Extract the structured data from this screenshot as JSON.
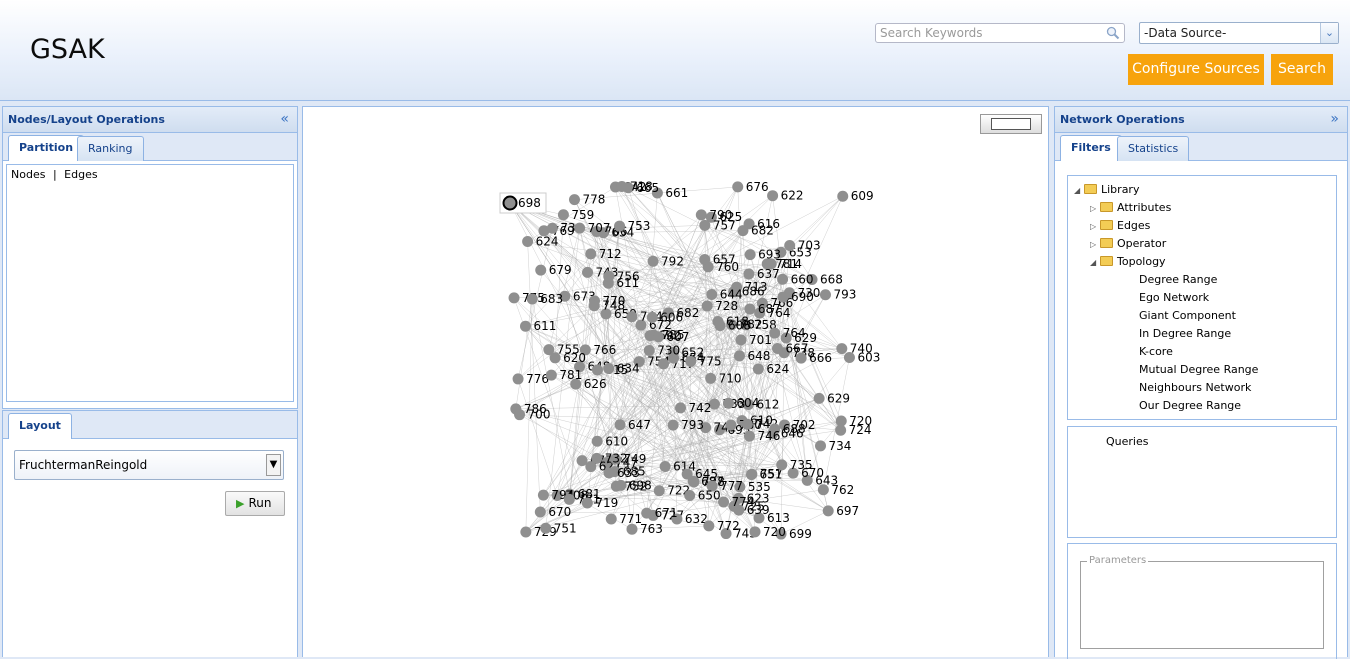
{
  "app_title": "GSAK",
  "search": {
    "placeholder": "Search Keywords",
    "icon": "magnifier-icon"
  },
  "data_source": {
    "selected": "-Data Source-"
  },
  "buttons": {
    "configure": "Configure Sources",
    "search": "Search"
  },
  "left_panel": {
    "title": "Nodes/Layout Operations",
    "tabs": [
      "Partition",
      "Ranking"
    ],
    "active_tab": "Partition",
    "partition": {
      "nodes": "Nodes",
      "separator": "|",
      "edges": "Edges"
    }
  },
  "layout_panel": {
    "tab": "Layout",
    "algorithm": "FruchtermanReingold",
    "run": "Run"
  },
  "right_panel": {
    "title": "Network Operations",
    "tabs": [
      "Filters",
      "Statistics"
    ],
    "active_tab": "Filters",
    "tree": {
      "library": "Library",
      "folders": [
        "Attributes",
        "Edges",
        "Operator"
      ],
      "topology": "Topology",
      "topology_items": [
        "Degree Range",
        "Ego Network",
        "Giant Component",
        "In Degree Range",
        "K-core",
        "Mutual Degree Range",
        "Neighbours Network",
        "Our Degree Range"
      ]
    },
    "queries": "Queries",
    "parameters": "Parameters"
  },
  "graph": {
    "selected_node": "698",
    "node_color": "#8f8f8f",
    "edge_color": "#a8a8a8",
    "node_labels": [
      "698",
      "686",
      "745",
      "610",
      "681",
      "651",
      "766",
      "653",
      "760",
      "677",
      "643",
      "755",
      "764",
      "659",
      "762",
      "785",
      "703",
      "673",
      "754",
      "740",
      "781",
      "722",
      "730",
      "687",
      "616",
      "625",
      "758",
      "637",
      "672",
      "727",
      "661",
      "766",
      "676",
      "611",
      "792",
      "738",
      "728",
      "695",
      "776",
      "717",
      "713",
      "632",
      "648",
      "629",
      "786",
      "782",
      "702",
      "747",
      "603",
      "626",
      "535",
      "741",
      "670",
      "679",
      "614",
      "752",
      "621",
      "692",
      "775",
      "757",
      "699",
      "777",
      "642",
      "615",
      "780",
      "648",
      "725",
      "682",
      "657",
      "701",
      "647",
      "744",
      "770",
      "781",
      "724",
      "645",
      "690",
      "652",
      "708",
      "665",
      "618",
      "769",
      "736",
      "646",
      "687",
      "766",
      "793",
      "794",
      "763",
      "743",
      "772",
      "610",
      "685",
      "634",
      "624",
      "742",
      "654",
      "622",
      "620",
      "682",
      "612",
      "728",
      "607",
      "644",
      "697",
      "608",
      "668",
      "611",
      "671",
      "609",
      "606",
      "781",
      "771",
      "720",
      "667",
      "623",
      "749",
      "733",
      "790",
      "734",
      "700",
      "633",
      "613",
      "650",
      "707",
      "719",
      "660",
      "698",
      "688",
      "693",
      "670",
      "714",
      "759",
      "748",
      "654",
      "683",
      "774",
      "778",
      "732",
      "742",
      "757",
      "629",
      "604",
      "753",
      "710",
      "764",
      "729",
      "735",
      "712",
      "639",
      "730",
      "720",
      "793",
      "775",
      "746",
      "756",
      "624",
      "666",
      "718",
      "751"
    ]
  }
}
